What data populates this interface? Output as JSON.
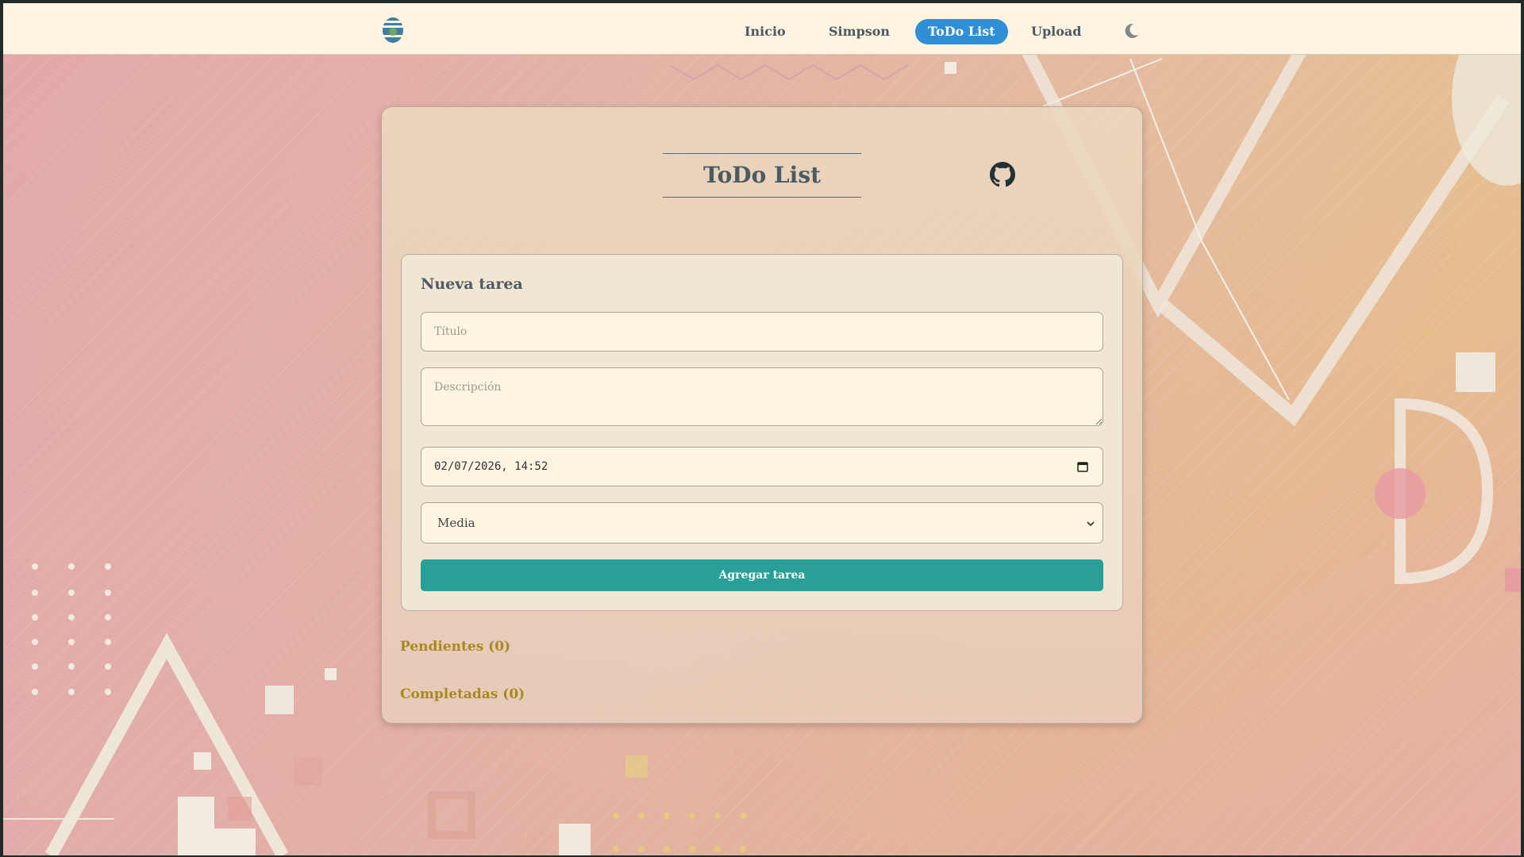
{
  "nav": {
    "items": [
      {
        "label": "Inicio",
        "active": false
      },
      {
        "label": "Simpson",
        "active": false
      },
      {
        "label": "ToDo List",
        "active": true
      },
      {
        "label": "Upload",
        "active": false
      }
    ],
    "logo_icon": "globe-logo-icon",
    "theme_toggle_icon": "moon-icon"
  },
  "page": {
    "title": "ToDo List",
    "github_icon": "github-icon"
  },
  "form": {
    "heading": "Nueva tarea",
    "title_placeholder": "Título",
    "description_placeholder": "Descripción",
    "datetime_value": "02/07/2026, 14:52",
    "priority_selected": "Media",
    "submit_label": "Agregar tarea"
  },
  "sections": {
    "pending": "Pendientes (0)",
    "completed": "Completadas (0)"
  },
  "colors": {
    "nav_active": "#2f8fd6",
    "submit_button": "#289f97",
    "section_label": "#a8891f",
    "header_bg": "#fdf5e1"
  }
}
